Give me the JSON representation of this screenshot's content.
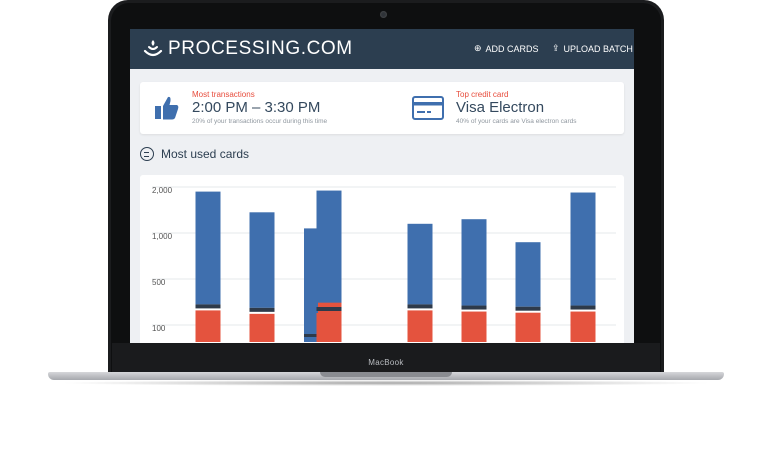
{
  "device": {
    "brand_label": "MacBook"
  },
  "app": {
    "logo_text": "PROCESSING.COM",
    "nav": {
      "add_cards_label": "ADD CARDS",
      "upload_batch_label": "UPLOAD BATCH"
    }
  },
  "stats": {
    "most_transactions": {
      "label": "Most transactions",
      "value": "2:00 PM – 3:30 PM",
      "note": "20% of your transactions occur during this time",
      "icon": "thumbs-up-icon"
    },
    "top_credit_card": {
      "label": "Top credit card",
      "value": "Visa Electron",
      "note": "40% of your cards are Visa electron cards",
      "icon": "credit-card-icon"
    }
  },
  "section": {
    "title": "Most used cards",
    "icon": "credit-card-circle-icon"
  },
  "colors": {
    "topbar": "#2c3e50",
    "accent_red": "#e74c3c",
    "bar_blue": "#3f6fae",
    "bar_red": "#e4533e",
    "bar_dark": "#2e3a4a"
  },
  "chart_data": {
    "type": "bar",
    "stacked": true,
    "y_ticks": [
      "2,000",
      "1,000",
      "500",
      "100"
    ],
    "grid": true,
    "series": [
      {
        "values": [
          1900,
          1450,
          0,
          1920,
          1200,
          1300,
          900,
          1880
        ]
      },
      {
        "values": [
          140,
          110,
          0,
          260,
          140,
          130,
          120,
          130
        ]
      }
    ],
    "partial_bar": {
      "index": 2,
      "value": 1100
    }
  }
}
